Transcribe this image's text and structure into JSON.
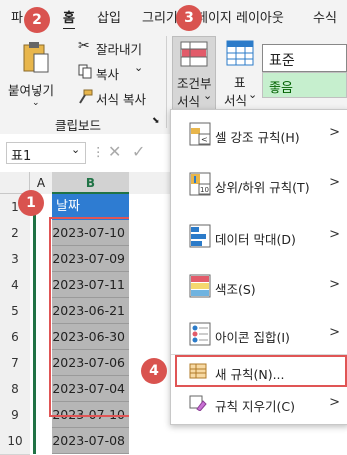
{
  "tabs": [
    {
      "label": "파"
    },
    {
      "label": "홈"
    },
    {
      "label": "삽입"
    },
    {
      "label": "그리기"
    },
    {
      "label": "페이지 레이아웃"
    },
    {
      "label": "수식"
    }
  ],
  "clipboard": {
    "paste_label": "붙여넣기",
    "cut_label": "잘라내기",
    "copy_label": "복사",
    "format_painter_label": "서식 복사",
    "group_label": "클립보드"
  },
  "styles": {
    "conditional_formatting_line1": "조건부",
    "conditional_formatting_line2": "서식",
    "format_table_line1": "표",
    "format_table_line2": "서식",
    "style_normal": "표준",
    "style_good": "좋음",
    "colors": {
      "good_bg": "#c6efce",
      "good_text": "#006100"
    }
  },
  "formula_bar": {
    "name_box": "표1"
  },
  "sheet": {
    "col_a": "A",
    "col_b": "B",
    "row_numbers": [
      "1",
      "2",
      "3",
      "4",
      "5",
      "6",
      "7",
      "8",
      "9",
      "10"
    ],
    "header_cell": "날짜",
    "dates": [
      "2023-07-10",
      "2023-07-09",
      "2023-07-11",
      "2023-06-21",
      "2023-06-30",
      "2023-07-06",
      "2023-07-04",
      "2023-07-10",
      "2023-07-08"
    ]
  },
  "menu": {
    "items": [
      {
        "label": "셀 강조 규칙(H)",
        "icon": "highlight-cells-rules-icon"
      },
      {
        "label": "상위/하위 규칙(T)",
        "icon": "top-bottom-rules-icon"
      },
      {
        "label": "데이터 막대(D)",
        "icon": "data-bars-icon"
      },
      {
        "label": "색조(S)",
        "icon": "color-scales-icon"
      },
      {
        "label": "아이콘 집합(I)",
        "icon": "icon-sets-icon"
      },
      {
        "label": "새 규칙(N)...",
        "icon": "new-rule-icon"
      },
      {
        "label": "규칙 지우기(C)",
        "icon": "clear-rules-icon"
      }
    ]
  },
  "badges": [
    "1",
    "2",
    "3",
    "4"
  ],
  "accent_colors": {
    "badge": "#d9534f",
    "highlight_border": "#e05555",
    "green": "#217346"
  }
}
